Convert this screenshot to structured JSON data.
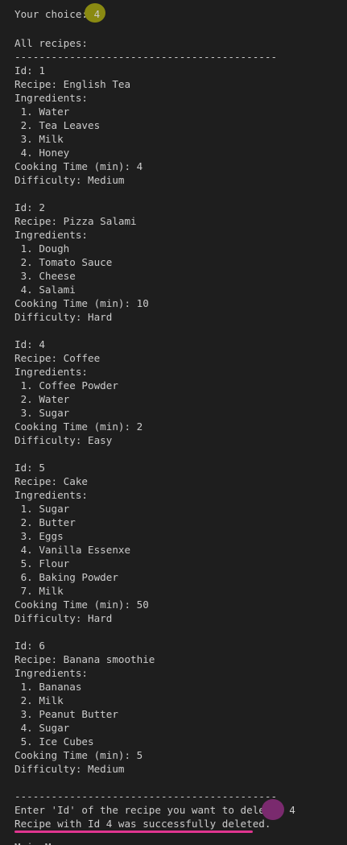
{
  "prompt": {
    "label": "Your choice: ",
    "value": "4"
  },
  "header": "All recipes:",
  "separator": "-------------------------------------------",
  "recipes": [
    {
      "id_line": "Id: 1",
      "name_line": "Recipe: English Tea",
      "ingredients_label": "Ingredients:",
      "ingredients": [
        " 1. Water",
        " 2. Tea Leaves",
        " 3. Milk",
        " 4. Honey"
      ],
      "time_line": "Cooking Time (min): 4",
      "difficulty_line": "Difficulty: Medium"
    },
    {
      "id_line": "Id: 2",
      "name_line": "Recipe: Pizza Salami",
      "ingredients_label": "Ingredients:",
      "ingredients": [
        " 1. Dough",
        " 2. Tomato Sauce",
        " 3. Cheese",
        " 4. Salami"
      ],
      "time_line": "Cooking Time (min): 10",
      "difficulty_line": "Difficulty: Hard"
    },
    {
      "id_line": "Id: 4",
      "name_line": "Recipe: Coffee",
      "ingredients_label": "Ingredients:",
      "ingredients": [
        " 1. Coffee Powder",
        " 2. Water",
        " 3. Sugar"
      ],
      "time_line": "Cooking Time (min): 2",
      "difficulty_line": "Difficulty: Easy"
    },
    {
      "id_line": "Id: 5",
      "name_line": "Recipe: Cake",
      "ingredients_label": "Ingredients:",
      "ingredients": [
        " 1. Sugar",
        " 2. Butter",
        " 3. Eggs",
        " 4. Vanilla Essenxe",
        " 5. Flour",
        " 6. Baking Powder",
        " 7. Milk"
      ],
      "time_line": "Cooking Time (min): 50",
      "difficulty_line": "Difficulty: Hard"
    },
    {
      "id_line": "Id: 6",
      "name_line": "Recipe: Banana smoothie",
      "ingredients_label": "Ingredients:",
      "ingredients": [
        " 1. Bananas",
        " 2. Milk",
        " 3. Peanut Butter",
        " 4. Sugar",
        " 5. Ice Cubes"
      ],
      "time_line": "Cooking Time (min): 5",
      "difficulty_line": "Difficulty: Medium"
    }
  ],
  "delete_prompt": {
    "label": "Enter 'Id' of the recipe you want to delete: ",
    "value": "4"
  },
  "result": "Recipe with Id 4 was successfully deleted.",
  "next_line_partial": "Main Menu",
  "colors": {
    "background": "#1e1e1e",
    "text": "#cccccc",
    "highlight_yellow": "#8a8a12",
    "highlight_purple": "#7a2a6e",
    "underline_pink": "#e0358f"
  }
}
